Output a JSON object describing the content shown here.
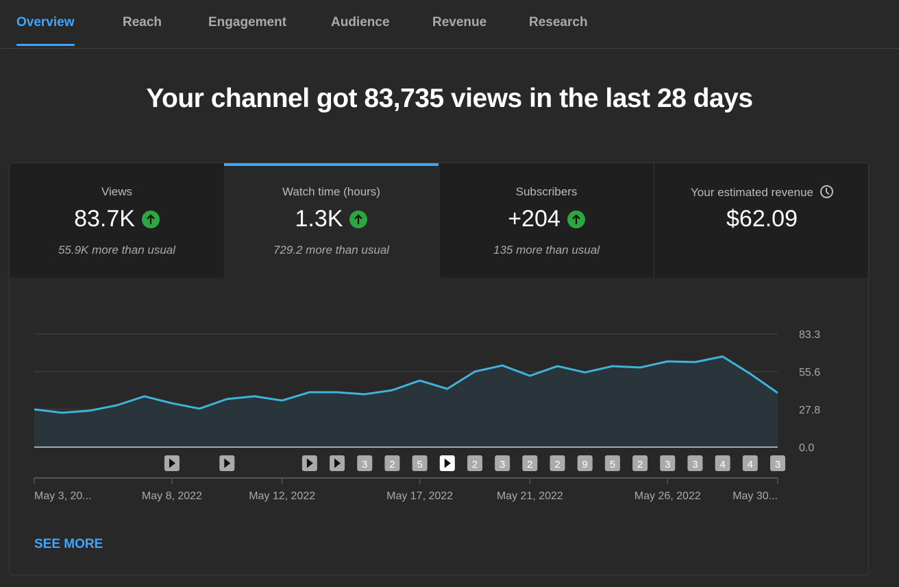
{
  "tabs": [
    {
      "label": "Overview",
      "active": true
    },
    {
      "label": "Reach"
    },
    {
      "label": "Engagement"
    },
    {
      "label": "Audience"
    },
    {
      "label": "Revenue"
    },
    {
      "label": "Research"
    }
  ],
  "headline": "Your channel got 83,735 views in the last 28 days",
  "cards": [
    {
      "label": "Views",
      "value": "83.7K",
      "trend": "up",
      "note": "55.9K more than usual"
    },
    {
      "label": "Watch time (hours)",
      "value": "1.3K",
      "trend": "up",
      "note": "729.2 more than usual",
      "selected": true
    },
    {
      "label": "Subscribers",
      "value": "+204",
      "trend": "up",
      "note": "135 more than usual"
    },
    {
      "label": "Your estimated revenue",
      "value": "$62.09",
      "icon": "clock-icon"
    }
  ],
  "see_more": "SEE MORE",
  "colors": {
    "accent": "#3ea6ff",
    "line": "#3eb4dc",
    "up": "#2ba640"
  },
  "chart_data": {
    "type": "area",
    "ylim": [
      0,
      83.3
    ],
    "yticks": [
      "83.3",
      "55.6",
      "27.8",
      "0.0"
    ],
    "ytick_values": [
      83.3,
      55.6,
      27.8,
      0
    ],
    "x": [
      "May 3, 2022",
      "May 4, 2022",
      "May 5, 2022",
      "May 6, 2022",
      "May 7, 2022",
      "May 8, 2022",
      "May 9, 2022",
      "May 10, 2022",
      "May 11, 2022",
      "May 12, 2022",
      "May 13, 2022",
      "May 14, 2022",
      "May 15, 2022",
      "May 16, 2022",
      "May 17, 2022",
      "May 18, 2022",
      "May 19, 2022",
      "May 20, 2022",
      "May 21, 2022",
      "May 22, 2022",
      "May 23, 2022",
      "May 24, 2022",
      "May 25, 2022",
      "May 26, 2022",
      "May 27, 2022",
      "May 28, 2022",
      "May 29, 2022",
      "May 30, 2022"
    ],
    "values": [
      27.8,
      25.3,
      26.8,
      30.8,
      37.4,
      32.3,
      28.3,
      35.4,
      37.4,
      34.3,
      40.4,
      40.4,
      38.9,
      41.9,
      49.0,
      42.9,
      55.6,
      60.1,
      52.5,
      59.6,
      55.0,
      59.6,
      58.6,
      63.1,
      62.6,
      66.7,
      54.0,
      39.9
    ],
    "xtick_labels": [
      {
        "index": 0,
        "label": "May 3, 20..."
      },
      {
        "index": 5,
        "label": "May 8, 2022"
      },
      {
        "index": 9,
        "label": "May 12, 2022"
      },
      {
        "index": 14,
        "label": "May 17, 2022"
      },
      {
        "index": 18,
        "label": "May 21, 2022"
      },
      {
        "index": 23,
        "label": "May 26, 2022"
      },
      {
        "index": 27,
        "label": "May 30..."
      }
    ],
    "video_markers": [
      {
        "index": 5,
        "label": "play"
      },
      {
        "index": 7,
        "label": "play"
      },
      {
        "index": 10,
        "label": "play"
      },
      {
        "index": 11,
        "label": "play"
      },
      {
        "index": 12,
        "label": "3"
      },
      {
        "index": 13,
        "label": "2"
      },
      {
        "index": 14,
        "label": "5"
      },
      {
        "index": 15,
        "label": "play",
        "highlighted": true
      },
      {
        "index": 16,
        "label": "2"
      },
      {
        "index": 17,
        "label": "3"
      },
      {
        "index": 18,
        "label": "2"
      },
      {
        "index": 19,
        "label": "2"
      },
      {
        "index": 20,
        "label": "9"
      },
      {
        "index": 21,
        "label": "5"
      },
      {
        "index": 22,
        "label": "2"
      },
      {
        "index": 23,
        "label": "3"
      },
      {
        "index": 24,
        "label": "3"
      },
      {
        "index": 25,
        "label": "4"
      },
      {
        "index": 26,
        "label": "4"
      },
      {
        "index": 27,
        "label": "3"
      }
    ],
    "grid": true
  }
}
